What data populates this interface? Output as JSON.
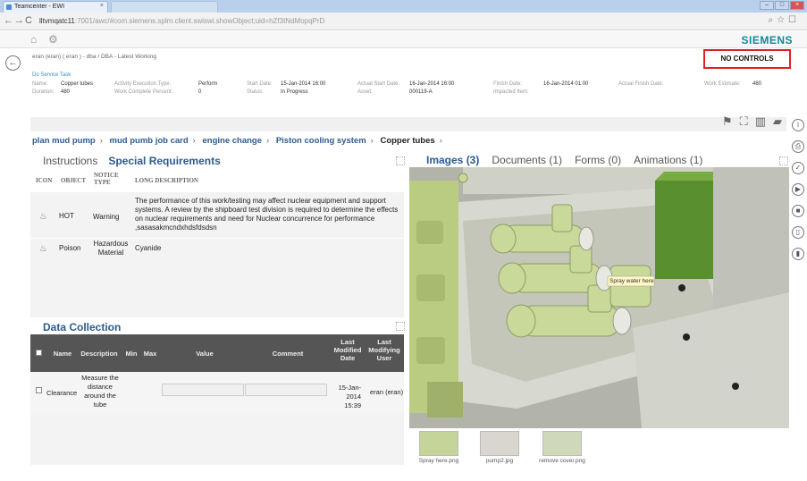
{
  "browser": {
    "tab_title": "Teamcenter - EWI",
    "url_host": "lltvmqatc11",
    "url_rest": ":7001/awc/#com.siemens.splm.client.swiswi.showObject;uid=hZf3tNdMopqPrD"
  },
  "app": {
    "brand": "SIEMENS",
    "context": "eran (eran) ( eran ) - dba / DBA - Latest Working",
    "no_controls": "NO CONTROLS",
    "task_link": "Do Service Task"
  },
  "properties": {
    "name_label": "Name:",
    "name_value": "Copper tubes",
    "duration_label": "Duration:",
    "duration_value": "480",
    "aet_label": "Activity Execution Type:",
    "aet_value": "Perform",
    "wcp_label": "Work Complete Percent:",
    "wcp_value": "0",
    "start_label": "Start Date:",
    "start_value": "15-Jan-2014 16:00",
    "status_label": "Status:",
    "status_value": "In Progress",
    "astart_label": "Actual Start Date:",
    "astart_value": "16-Jan-2014 16:00",
    "asset_label": "Asset:",
    "asset_value": "000119-A",
    "finish_label": "Finish Date:",
    "finish_value": "16-Jan-2014 01:00",
    "impacted_label": "Impacted Item:",
    "afinish_label": "Actual Finish Date:",
    "we_label": "Work Estimate:",
    "we_value": "480"
  },
  "breadcrumb": {
    "items": [
      "plan mud pump",
      "mud pumb job card",
      "engine change",
      "Piston cooling system"
    ],
    "current": "Copper tubes"
  },
  "left_panel": {
    "tabs": [
      "Instructions",
      "Special Requirements"
    ],
    "columns": [
      "ICON",
      "OBJECT",
      "NOTICE TYPE",
      "LONG DESCRIPTION"
    ],
    "rows": [
      {
        "object": "HOT",
        "notice": "Warning",
        "description": "The performance of this work/testing may affect nuclear equipment and support systems. A review by the shipboard test division is required to determine the effects on nuclear requirements and need for Nuclear concurrence for performance ,sasasakmcndxhdsfdsdsn"
      },
      {
        "object": "Poison",
        "notice": "Hazardous Material",
        "description": "Cyanide"
      }
    ]
  },
  "data_collection": {
    "title": "Data Collection",
    "columns": [
      "Name",
      "Description",
      "Min",
      "Max",
      "Value",
      "Comment",
      "Last Modified Date",
      "Last Modifying User"
    ],
    "row": {
      "name": "Clearance",
      "description": "Measure the distance around the tube",
      "min": "",
      "max": "",
      "value": "",
      "comment": "",
      "date": "15-Jan-2014 15:39",
      "user": "eran (eran)"
    }
  },
  "right_panel": {
    "tabs": [
      "Images (3)",
      "Documents (1)",
      "Forms (0)",
      "Animations (1)"
    ],
    "callout": "Spray water here",
    "thumbnails": [
      "Spray here.png",
      "pump2.jpg",
      "remove cover.png"
    ]
  },
  "colors": {
    "accent": "#2c5b8e",
    "brand": "#0e8a99",
    "alert_border": "#dd2222",
    "part_green": "#c9d99a"
  }
}
